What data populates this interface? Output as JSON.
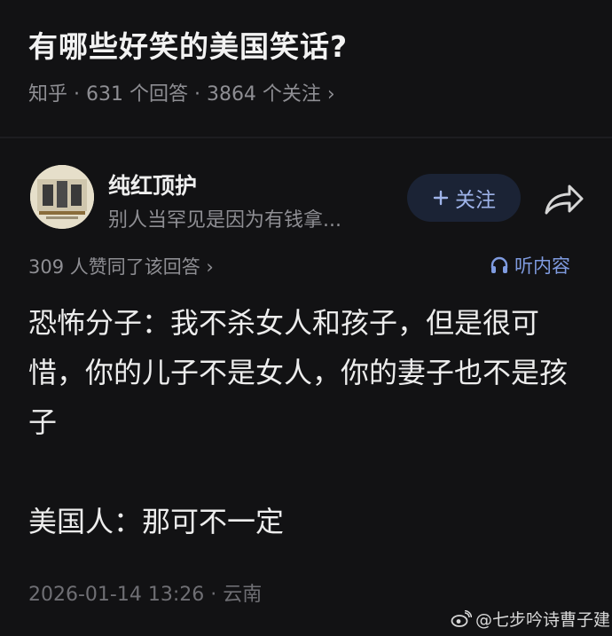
{
  "question": {
    "title": "有哪些好笑的美国笑话?",
    "meta": "知乎 · 631 个回答 · 3864 个关注 ›"
  },
  "author": {
    "name": "纯红顶护",
    "bio": "别人当罕见是因为有钱拿...",
    "follow_label": "关注",
    "follow_icon": "plus-icon"
  },
  "answer": {
    "upvote_text": "309 人赞同了该回答 ›",
    "listen_label": "听内容",
    "paragraphs": [
      "恐怖分子：我不杀女人和孩子，但是很可惜，你的儿子不是女人，你的妻子也不是孩子",
      "美国人：那可不一定"
    ],
    "timestamp": "2026-01-14 13:26 · 云南"
  },
  "watermark": {
    "text": "@七步吟诗曹子建",
    "icon": "weibo-icon"
  },
  "colors": {
    "background": "#121214",
    "accent": "#7f9be0",
    "follow_bg": "#1b2335",
    "muted": "#8e8e93"
  }
}
